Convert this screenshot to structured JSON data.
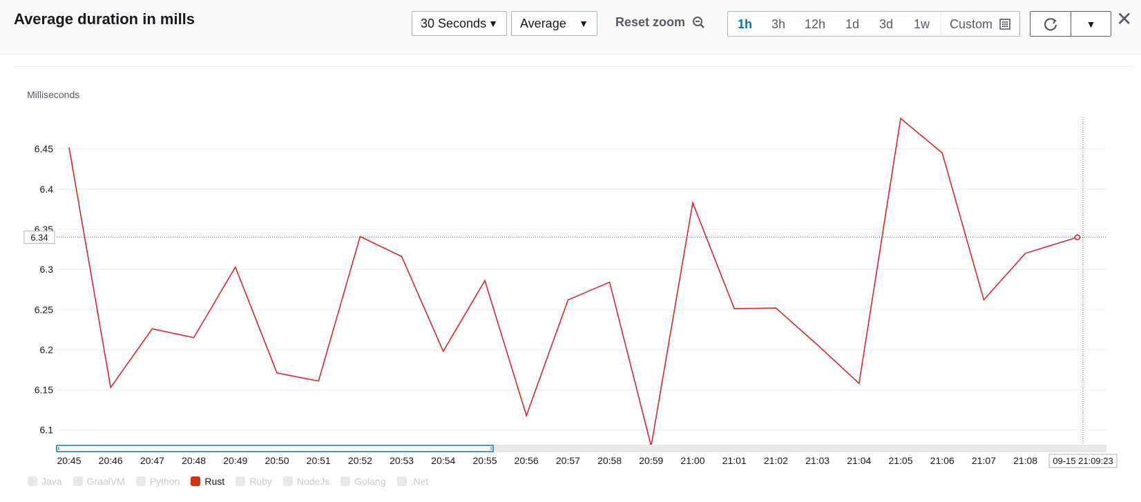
{
  "header": {
    "title": "Average duration in mills",
    "period": "30 Seconds",
    "statistic": "Average",
    "reset_zoom": "Reset zoom",
    "ranges": [
      "1h",
      "3h",
      "12h",
      "1d",
      "3d",
      "1w"
    ],
    "active_range": "1h",
    "custom": "Custom"
  },
  "colors": {
    "series": "#d9252b",
    "accent": "#0073bb",
    "text": "#16191f",
    "muted": "#545b64"
  },
  "chart_data": {
    "type": "line",
    "ylabel": "Milliseconds",
    "ylim": [
      6.08,
      6.5
    ],
    "yticks": [
      "6.1",
      "6.15",
      "6.2",
      "6.25",
      "6.3",
      "6.35",
      "6.4",
      "6.45"
    ],
    "x": [
      "20:45",
      "20:45:30",
      "20:46",
      "20:46:30",
      "20:47",
      "20:47:30",
      "20:48",
      "20:48:30",
      "20:49",
      "20:49:30",
      "20:50",
      "20:50:30",
      "20:51",
      "20:51:30",
      "20:52",
      "20:52:30",
      "20:53",
      "20:53:30",
      "20:54",
      "20:54:30",
      "20:55",
      "20:55:30",
      "20:56",
      "20:56:30",
      "20:57",
      "20:57:30",
      "20:58",
      "20:58:30",
      "20:59"
    ],
    "xticks": [
      "20:45",
      "20:46",
      "20:47",
      "20:48",
      "20:49",
      "20:50",
      "20:51",
      "20:52",
      "20:53",
      "20:54",
      "20:55",
      "20:56",
      "20:57",
      "20:58",
      "20:59",
      "21:00",
      "21:01",
      "21:02",
      "21:03",
      "21:04",
      "21:05",
      "21:06",
      "21:07",
      "21:08"
    ],
    "series": [
      {
        "name": "Rust",
        "x_minutes": [
          0,
          1,
          2,
          3,
          4,
          5,
          6,
          7,
          8,
          9,
          10,
          11,
          12,
          13,
          14,
          15,
          16,
          17,
          18,
          19,
          20,
          21,
          22,
          23,
          24.25
        ],
        "values": [
          6.452,
          6.153,
          6.226,
          6.215,
          6.303,
          6.171,
          6.161,
          6.341,
          6.316,
          6.198,
          6.286,
          6.118,
          6.262,
          6.284,
          6.08,
          6.383,
          6.251,
          6.252,
          6.206,
          6.158,
          6.488,
          6.445,
          6.262,
          6.32,
          6.34
        ]
      }
    ],
    "crosshair_value": "6.34",
    "crosshair_time": "09-15 21:09:23"
  },
  "legend": [
    {
      "label": "Java",
      "active": false
    },
    {
      "label": "GraalVM",
      "active": false
    },
    {
      "label": "Python",
      "active": false
    },
    {
      "label": "Rust",
      "active": true
    },
    {
      "label": "Ruby",
      "active": false
    },
    {
      "label": "NodeJs",
      "active": false
    },
    {
      "label": "Golang",
      "active": false
    },
    {
      "label": ".Net",
      "active": false
    }
  ]
}
